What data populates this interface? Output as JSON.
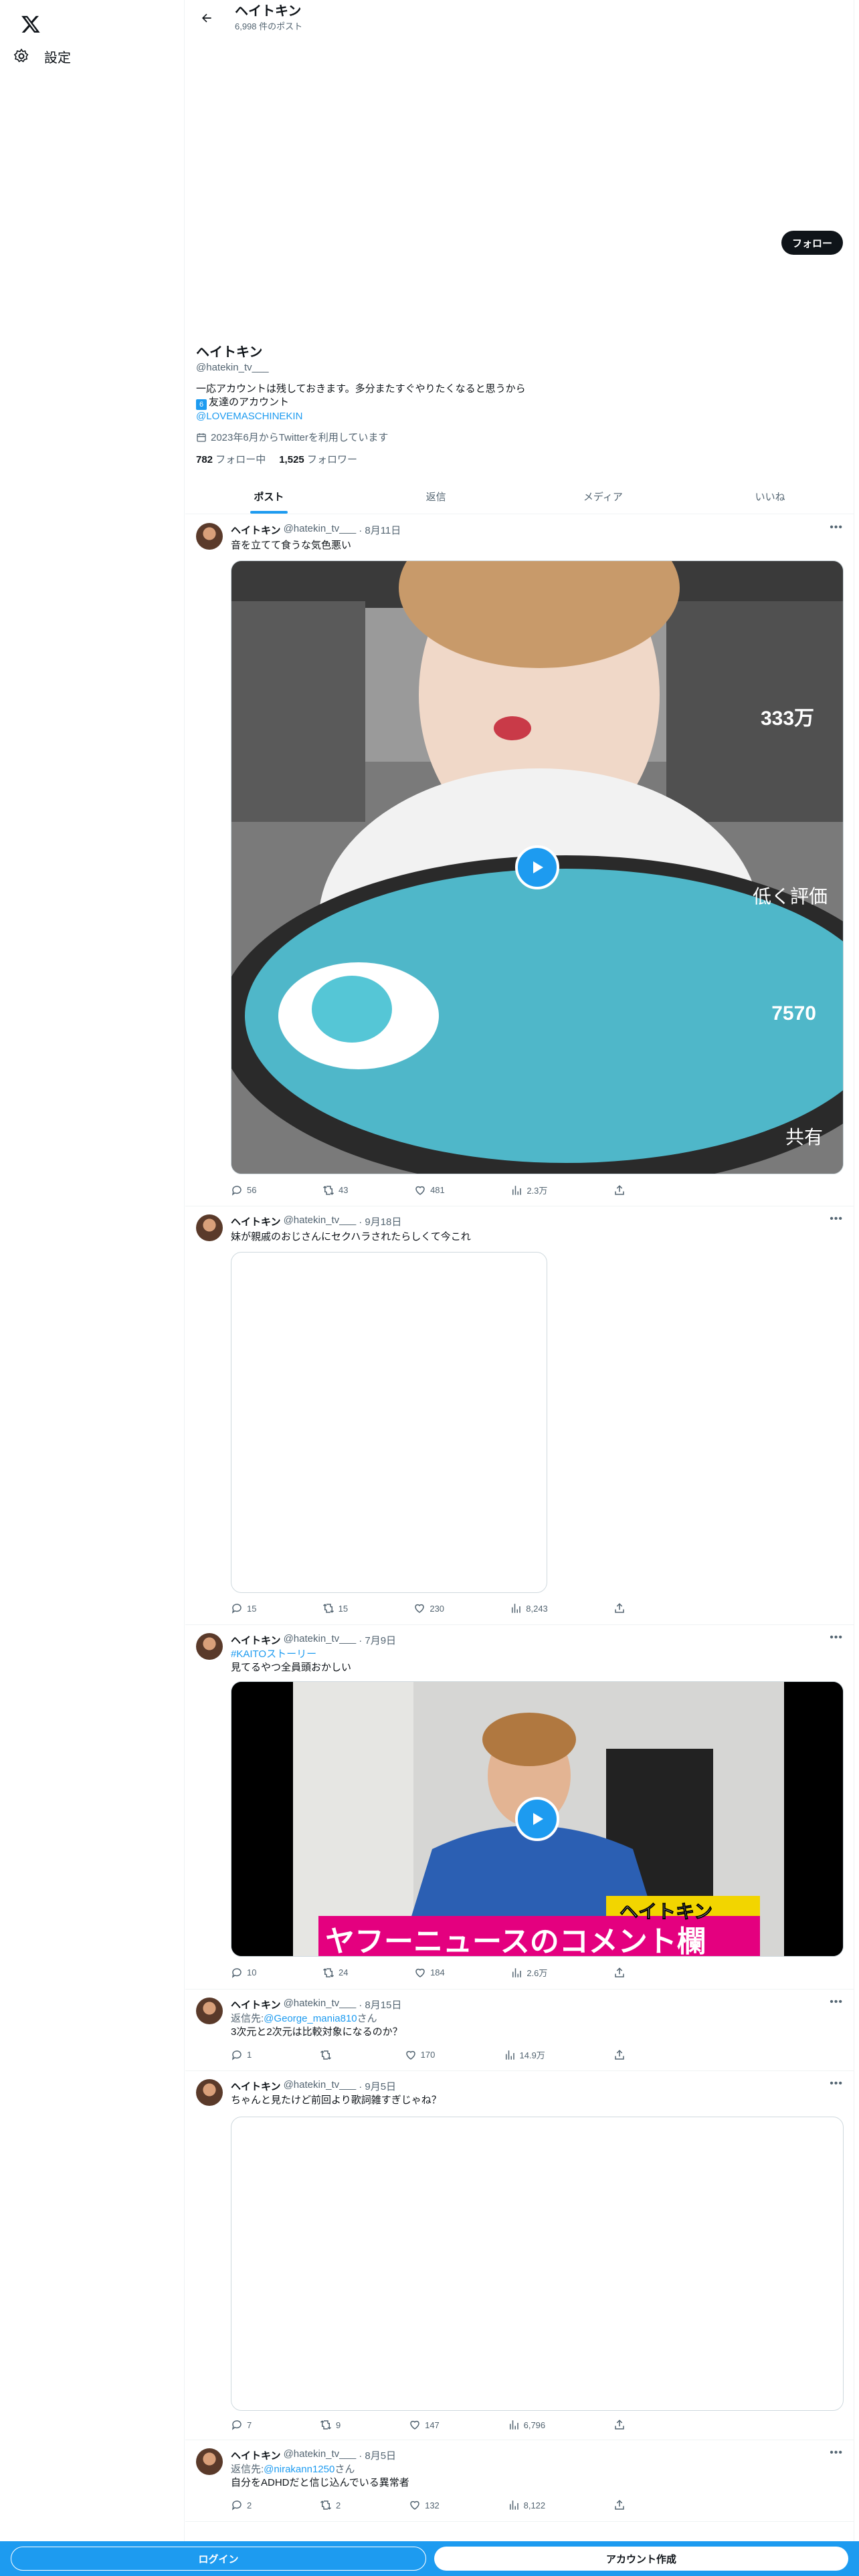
{
  "nav": {
    "settings_label": "設定"
  },
  "header": {
    "name": "ヘイトキン",
    "post_count": "6,998 件のポスト"
  },
  "profile": {
    "display_name": "ヘイトキン",
    "handle": "@hatekin_tv___",
    "follow_label": "フォロー",
    "bio_line1": "一応アカウントは残しておきます。多分またすぐやりたくなると思うから",
    "bio_badge": "6",
    "bio_line2": "友達のアカウント",
    "bio_link": "@LOVEMASCHINEKIN",
    "joined": "2023年6月からTwitterを利用しています",
    "following_count": "782",
    "following_label": "フォロー中",
    "followers_count": "1,525",
    "followers_label": "フォロワー"
  },
  "tabs": [
    "ポスト",
    "返信",
    "メディア",
    "いいね"
  ],
  "tweets": [
    {
      "name": "ヘイトキン",
      "handle": "@hatekin_tv___",
      "date": "· 8月11日",
      "text": "音を立てて食うな気色悪い",
      "replies": "56",
      "retweets": "43",
      "likes": "481",
      "views": "2.3万",
      "overlay": {
        "likes": "333万",
        "dislike": "低く評価",
        "comments": "7570",
        "share": "共有"
      }
    },
    {
      "name": "ヘイトキン",
      "handle": "@hatekin_tv___",
      "date": "· 9月18日",
      "text": "妹が親戚のおじさんにセクハラされたらしくて今これ",
      "replies": "15",
      "retweets": "15",
      "likes": "230",
      "views": "8,243"
    },
    {
      "name": "ヘイトキン",
      "handle": "@hatekin_tv___",
      "date": "· 7月9日",
      "hashtag": "#KAITOストーリー",
      "text": "見てるやつ全員頭おかしい",
      "replies": "10",
      "retweets": "24",
      "likes": "184",
      "views": "2.6万",
      "overlay": {
        "name_tag": "ヘイトキン",
        "caption": "ヤフーニュースのコメント欄"
      }
    },
    {
      "name": "ヘイトキン",
      "handle": "@hatekin_tv___",
      "date": "· 8月15日",
      "reply_prefix": "返信先:",
      "reply_to": "@George_mania810",
      "reply_suffix": "さん",
      "text": "3次元と2次元は比較対象になるのか？",
      "replies": "1",
      "retweets": "",
      "likes": "170",
      "views": "14.9万"
    },
    {
      "name": "ヘイトキン",
      "handle": "@hatekin_tv___",
      "date": "· 9月5日",
      "text": "ちゃんと見たけど前回より歌詞雑すぎじゃね？",
      "replies": "7",
      "retweets": "9",
      "likes": "147",
      "views": "6,796"
    },
    {
      "name": "ヘイトキン",
      "handle": "@hatekin_tv___",
      "date": "· 8月5日",
      "reply_prefix": "返信先:",
      "reply_to": "@nirakann1250",
      "reply_suffix": "さん",
      "text": "自分をADHDだと信じ込んでいる異常者",
      "replies": "2",
      "retweets": "2",
      "likes": "132",
      "views": "8,122"
    }
  ],
  "bottom": {
    "login": "ログイン",
    "signup": "アカウント作成"
  },
  "colors": {
    "accent": "#1d9bf0",
    "text": "#0f1419",
    "muted": "#536471"
  }
}
